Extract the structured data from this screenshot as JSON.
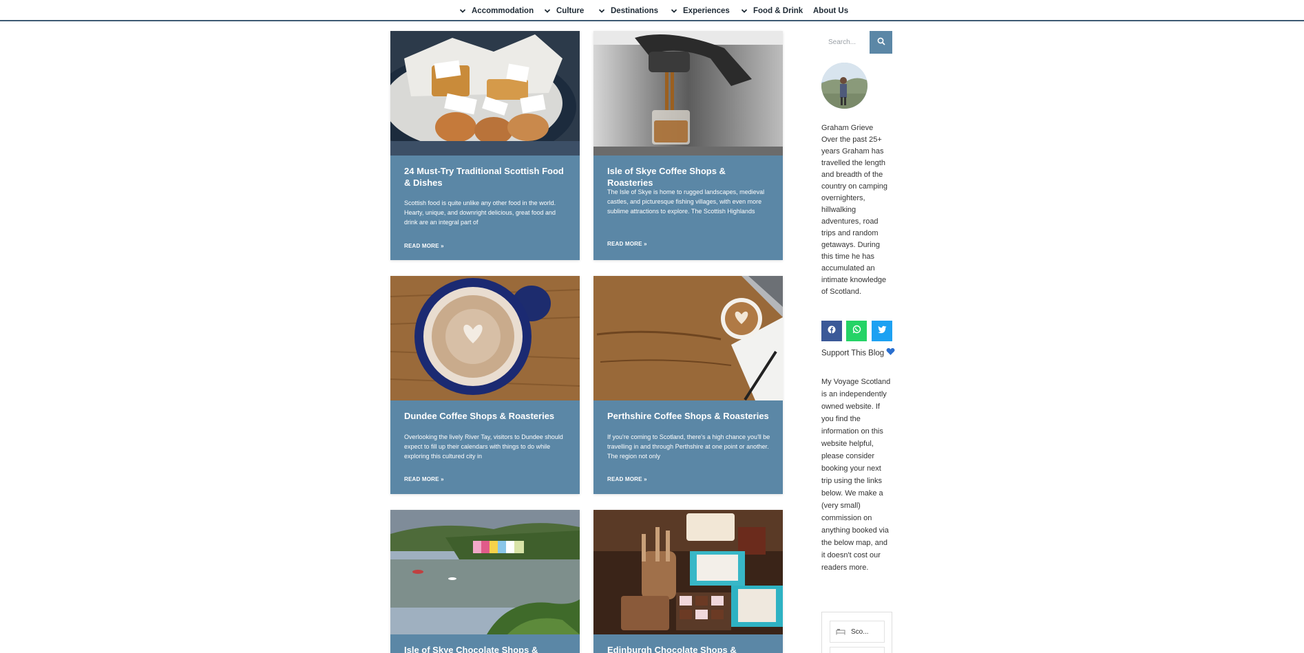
{
  "nav": {
    "items": [
      {
        "label": "Accommodation",
        "has_dropdown": true
      },
      {
        "label": "Culture",
        "has_dropdown": true
      },
      {
        "label": "Destinations",
        "has_dropdown": true
      },
      {
        "label": "Experiences",
        "has_dropdown": true
      },
      {
        "label": "Food & Drink",
        "has_dropdown": true
      },
      {
        "label": "About Us",
        "has_dropdown": false
      }
    ]
  },
  "posts": [
    {
      "title": "24 Must-Try Traditional Scottish Food & Dishes",
      "excerpt": "Scottish food is quite unlike any other food in the world. Hearty, unique, and downright delicious, great food and drink are an integral part of",
      "read_more": "READ MORE »",
      "image": "scottish-food-basket-image"
    },
    {
      "title": "Isle of Skye Coffee Shops & Roasteries",
      "excerpt": "The Isle of Skye is home to rugged landscapes, medieval castles, and picturesque fishing villages, with even more sublime attractions to explore. The Scottish Highlands",
      "read_more": "READ MORE »",
      "image": "espresso-machine-image"
    },
    {
      "title": "Dundee Coffee Shops & Roasteries",
      "excerpt": "Overlooking the lively River Tay, visitors to Dundee should expect to fill up their calendars with things to do while exploring this cultured city in",
      "read_more": "READ MORE »",
      "image": "latte-art-blue-cup-image"
    },
    {
      "title": "Perthshire Coffee Shops & Roasteries",
      "excerpt": "If you're coming to Scotland, there's a high chance you'll be travelling in and through Perthshire at one point or another. The region not only",
      "read_more": "READ MORE »",
      "image": "coffee-on-wooden-desk-image"
    },
    {
      "title": "Isle of Skye Chocolate Shops &",
      "excerpt": "",
      "read_more": "",
      "image": "portree-harbour-image"
    },
    {
      "title": "Edinburgh Chocolate Shops &",
      "excerpt": "",
      "read_more": "",
      "image": "chocolate-shop-display-image"
    }
  ],
  "sidebar": {
    "search_placeholder": "Search...",
    "author_name": "Graham Grieve",
    "author_bio": "Over the past 25+ years Graham has travelled the length and breadth of the country on camping overnighters, hillwalking adventures, road trips and random getaways. During this time he has accumulated an intimate knowledge of Scotland.",
    "social": [
      {
        "icon": "facebook-icon",
        "color": "#3b5998"
      },
      {
        "icon": "whatsapp-icon",
        "color": "#25d366"
      },
      {
        "icon": "twitter-icon",
        "color": "#1da1f2"
      }
    ],
    "support_title": "Support This Blog",
    "support_body": "My Voyage Scotland is an independently owned website. If you find the information on this website helpful, please consider booking your next trip using the links below. We make a (very small) commission on anything booked via the below map, and it doesn't cost our readers more.",
    "widget_field_value": "Sco..."
  },
  "colors": {
    "card_bg": "#5b87a6",
    "nav_border": "#3d5a73",
    "heart": "#2a6fcf"
  }
}
